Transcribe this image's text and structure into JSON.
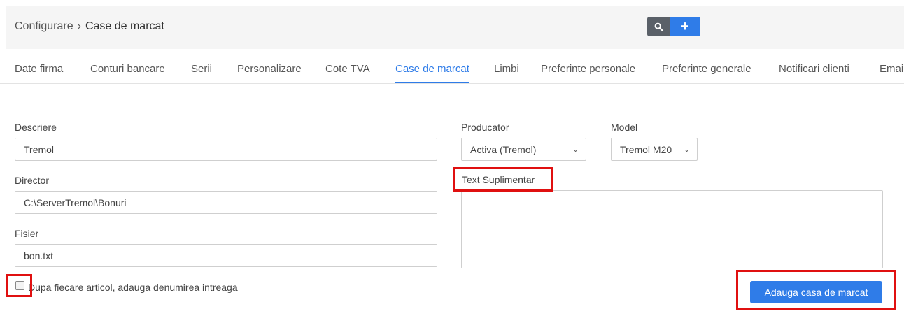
{
  "breadcrumb": {
    "parent": "Configurare",
    "separator": "›",
    "current": "Case de marcat"
  },
  "toolbar": {
    "search_icon": "search-icon",
    "add_label": "+"
  },
  "tabs": [
    {
      "label": "Date firma"
    },
    {
      "label": "Conturi bancare"
    },
    {
      "label": "Serii"
    },
    {
      "label": "Personalizare"
    },
    {
      "label": "Cote TVA"
    },
    {
      "label": "Case de marcat",
      "active": true
    },
    {
      "label": "Limbi"
    },
    {
      "label": "Preferinte personale"
    },
    {
      "label": "Preferinte generale"
    },
    {
      "label": "Notificari clienti"
    },
    {
      "label": "Emai"
    }
  ],
  "form": {
    "descriere": {
      "label": "Descriere",
      "value": "Tremol"
    },
    "director": {
      "label": "Director",
      "value": "C:\\ServerTremol\\Bonuri"
    },
    "fisier": {
      "label": "Fisier",
      "value": "bon.txt"
    },
    "producator": {
      "label": "Producator",
      "value": "Activa (Tremol)"
    },
    "model": {
      "label": "Model",
      "value": "Tremol M20"
    },
    "text_suplimentar": {
      "label": "Text Suplimentar",
      "value": ""
    },
    "checkbox": {
      "label": "Dupa fiecare articol, adauga denumirea intreaga",
      "checked": false
    },
    "submit_label": "Adauga casa de marcat"
  },
  "colors": {
    "accent": "#2f7ce8",
    "highlight": "#e01010",
    "search_button": "#5a6068"
  }
}
